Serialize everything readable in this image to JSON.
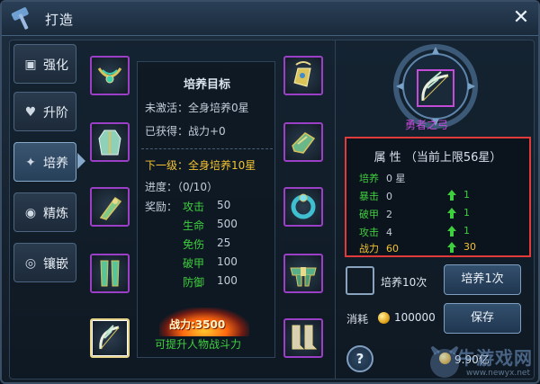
{
  "window": {
    "title": "打造"
  },
  "tabs": [
    {
      "label": "强化",
      "icon": "anvil-icon"
    },
    {
      "label": "升阶",
      "icon": "heart-icon"
    },
    {
      "label": "培养",
      "icon": "sparkle-icon",
      "active": true
    },
    {
      "label": "精炼",
      "icon": "gem-icon"
    },
    {
      "label": "镶嵌",
      "icon": "eye-icon"
    }
  ],
  "slots_left": [
    "necklace-item",
    "robe-item",
    "bracer-item",
    "leggings-item",
    "bow-item"
  ],
  "slots_right": [
    "amulet-item",
    "gauntlet-item",
    "ring-item",
    "belt-item",
    "boots-item"
  ],
  "info": {
    "title": "培养目标",
    "inactive_label": "未激活：全身培养0星",
    "obtained_label": "已获得：战力+0",
    "next_level_label": "下一级：全身培养10星",
    "progress_label": "进度：（0/10）",
    "reward_prefix": "奖励：",
    "rewards": [
      {
        "name": "攻击",
        "value": "50"
      },
      {
        "name": "生命",
        "value": "500"
      },
      {
        "name": "免伤",
        "value": "25"
      },
      {
        "name": "破甲",
        "value": "100"
      },
      {
        "name": "防御",
        "value": "100"
      }
    ],
    "power_label": "战力:3500",
    "hint": "可提升人物战斗力"
  },
  "weapon": {
    "name": "勇者之弓"
  },
  "attributes": {
    "title": "属 性  （当前上限56星）",
    "rows": [
      {
        "label": "培养",
        "value": "0 星",
        "inc": ""
      },
      {
        "label": "暴击",
        "value": "0",
        "inc": "1"
      },
      {
        "label": "破甲",
        "value": "2",
        "inc": "1"
      },
      {
        "label": "攻击",
        "value": "4",
        "inc": "1"
      },
      {
        "label": "战力",
        "value": "60",
        "inc": "30",
        "total": true
      }
    ]
  },
  "controls": {
    "train_ten_label": "培养10次",
    "train_once_label": "培养1次",
    "cost_label": "消耗",
    "cost_value": "100000",
    "save_label": "保存",
    "help_label": "?",
    "gold_value": "9.90亿"
  },
  "watermark": {
    "text": "牛游戏网",
    "url": "www.newyx.net"
  },
  "colors": {
    "accent_green": "#3ecf3e",
    "accent_yellow": "#f2c232",
    "slot_border": "#9b3fc6",
    "highlight_border": "#e03a3a"
  }
}
